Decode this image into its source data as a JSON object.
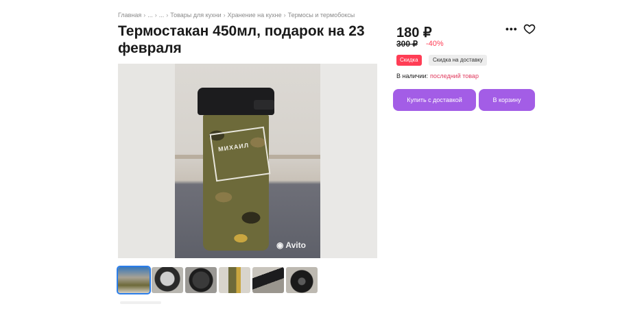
{
  "breadcrumb": {
    "items": [
      "Главная",
      "...",
      "...",
      "Товары для кухни",
      "Хранение на кухне",
      "Термосы и термобоксы"
    ],
    "separator": "›"
  },
  "product": {
    "title": "Термостакан 450мл, подарок на 23 февраля",
    "price": "180 ₽",
    "old_price": "300 ₽",
    "discount": "-40%",
    "badges": {
      "sale": "Скидка",
      "delivery_sale": "Скидка на доставку"
    },
    "availability_label": "В наличии:",
    "availability_value": "последний товар"
  },
  "gallery": {
    "image_text": "МИХАИЛ",
    "watermark": "Avito",
    "thumbnail_count": 6
  },
  "actions": {
    "buy_with_delivery": "Купить с доставкой",
    "add_to_cart": "В корзину"
  },
  "colors": {
    "accent": "#a35de6",
    "sale": "#ff3d55",
    "link": "#e03a5e"
  },
  "icons": {
    "more": "more-dots-icon",
    "favorite": "heart-icon"
  }
}
